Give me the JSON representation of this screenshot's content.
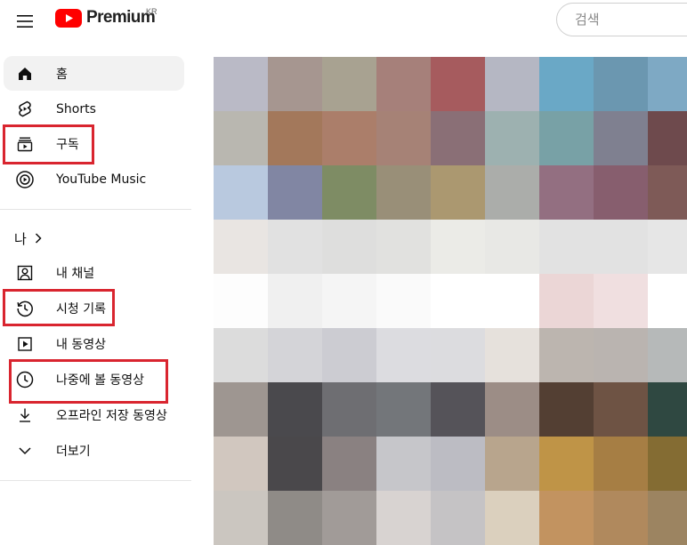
{
  "header": {
    "menu_icon": "hamburger-menu-icon",
    "logo_icon": "youtube-play-logo-icon",
    "logo_text": "Premium",
    "country_code": "KR",
    "search_placeholder": "검색",
    "search_value": ""
  },
  "sidebar": {
    "primary": [
      {
        "label": "홈",
        "icon": "home-icon",
        "active": true
      },
      {
        "label": "Shorts",
        "icon": "shorts-icon",
        "active": false
      },
      {
        "label": "구독",
        "icon": "subscriptions-icon",
        "active": false
      },
      {
        "label": "YouTube Music",
        "icon": "youtube-music-icon",
        "active": false
      }
    ],
    "you_section": {
      "title": "나",
      "title_icon": "chevron-right-icon",
      "items": [
        {
          "label": "내 채널",
          "icon": "your-channel-icon"
        },
        {
          "label": "시청 기록",
          "icon": "history-icon"
        },
        {
          "label": "내 동영상",
          "icon": "your-videos-icon"
        },
        {
          "label": "나중에 볼 동영상",
          "icon": "watch-later-icon"
        },
        {
          "label": "오프라인 저장 동영상",
          "icon": "download-icon"
        },
        {
          "label": "더보기",
          "icon": "chevron-down-icon"
        }
      ]
    }
  },
  "annotations": {
    "highlight_color": "#d9252f",
    "highlighted_items": [
      "구독",
      "시청 기록",
      "나중에 볼 동영상"
    ]
  },
  "thumbnail_grid": {
    "description_colors": [
      [
        "#babac6",
        "#a69690",
        "#a8a291",
        "#a6807a",
        "#a65b5e",
        "#b5b7c3",
        "#6aa8c6",
        "#6b97b0",
        "#7ea9c4"
      ],
      [
        "#b9b7b0",
        "#a3785b",
        "#ab7e6a",
        "#a68276",
        "#8a6f76",
        "#9db1b0",
        "#78a1a6",
        "#7f8090",
        "#6e4a4d"
      ],
      [
        "#b9c9df",
        "#8186a3",
        "#7e8c64",
        "#998f78",
        "#ab9870",
        "#abadaa",
        "#936f81",
        "#875e6e",
        "#7e5a57"
      ],
      [
        "#e9e5e2",
        "#e1e1e1",
        "#dededd",
        "#e1e1df",
        "#ebebe7",
        "#e8e8e5",
        "#e2e2e2",
        "#e2e2e2",
        "#e6e6e6"
      ],
      [
        "#fdfdfd",
        "#f0f0f0",
        "#f5f5f5",
        "#fafafa",
        "#ffffff",
        "#ffffff",
        "#ebd6d6",
        "#f0dfe0",
        "#ffffff"
      ],
      [
        "#dcdcdc",
        "#d4d4d8",
        "#ccccd2",
        "#dcdce0",
        "#dcdcdf",
        "#e6e1dc",
        "#bcb5af",
        "#bab4b0",
        "#b6b9b9"
      ],
      [
        "#9e9691",
        "#4a494d",
        "#6e6e72",
        "#73767a",
        "#555359",
        "#9c8d86",
        "#533f33",
        "#6e5344",
        "#2f4841"
      ],
      [
        "#d1c7bf",
        "#4a484b",
        "#8a8181",
        "#c6c6ca",
        "#bcbcc3",
        "#b8a58d",
        "#bf9447",
        "#a67e44",
        "#846c33"
      ],
      [
        "#cbc6c0",
        "#8f8b87",
        "#a19b98",
        "#d8d3d1",
        "#c5c3c5",
        "#dbd0be",
        "#c29360",
        "#b0895d",
        "#9c8461"
      ]
    ]
  }
}
